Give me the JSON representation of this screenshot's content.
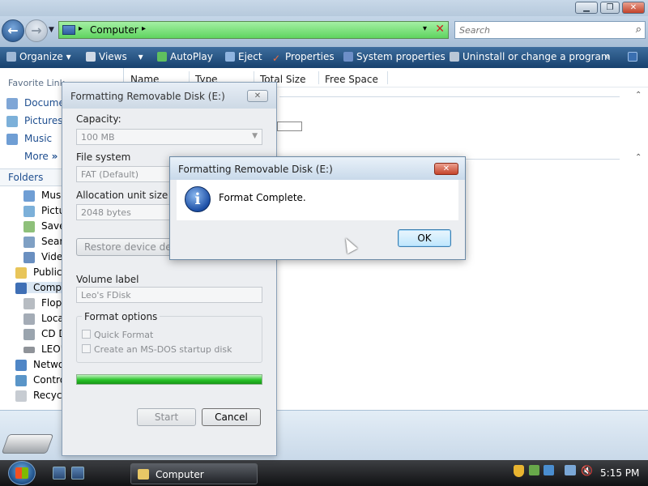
{
  "explorer": {
    "address": {
      "location": "Computer"
    },
    "search": {
      "placeholder": "Search"
    },
    "toolbar": {
      "organize": "Organize",
      "views": "Views",
      "autoplay": "AutoPlay",
      "eject": "Eject",
      "properties": "Properties",
      "system_properties": "System properties",
      "uninstall": "Uninstall or change a program",
      "more": "»"
    },
    "favorites": {
      "heading": "Favorite Link",
      "items": [
        "Docume",
        "Pictures",
        "Music"
      ],
      "more": "More"
    },
    "folders": {
      "heading": "Folders",
      "tree": [
        "Mus",
        "Pictu",
        "Save",
        "Sear",
        "Vide",
        "Public",
        "Comp",
        "Flop",
        "Loca",
        "CD D",
        "LEO'",
        "Netwo",
        "Contro",
        "Recycl"
      ]
    },
    "columns": [
      "Name",
      "Type",
      "Total Size",
      "Free Space"
    ]
  },
  "format_dialog": {
    "title": "Formatting Removable Disk (E:)",
    "capacity_label": "Capacity:",
    "capacity_value": "100 MB",
    "filesystem_label": "File system",
    "filesystem_value": "FAT (Default)",
    "allocation_label": "Allocation unit size",
    "allocation_value": "2048 bytes",
    "restore_button": "Restore device defaul",
    "volume_label": "Volume label",
    "volume_value": "Leo's FDisk",
    "format_options_label": "Format options",
    "quick_format": "Quick Format",
    "msdos_disk": "Create an MS-DOS startup disk",
    "progress": 1.0,
    "start_button": "Start",
    "cancel_button": "Cancel"
  },
  "message_box": {
    "title": "Formatting Removable Disk (E:)",
    "message": "Format Complete.",
    "ok_button": "OK"
  },
  "taskbar": {
    "task_label": "Computer",
    "clock": "5:15 PM"
  }
}
